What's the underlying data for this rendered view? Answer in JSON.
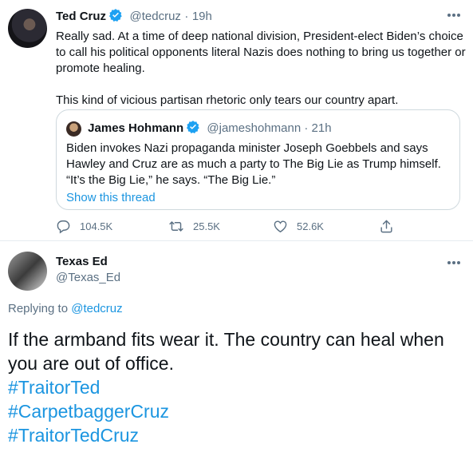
{
  "main_tweet": {
    "author_name": "Ted Cruz",
    "handle": "@tedcruz",
    "separator": "·",
    "time": "19h",
    "text_p1": "Really sad. At a time of deep national division, President-elect Biden’s choice to call his political opponents literal Nazis does nothing to bring us together or promote healing.",
    "text_p2": "This kind of vicious partisan rhetoric only tears our country apart.",
    "quoted": {
      "author_name": "James Hohmann",
      "handle": "@jameshohmann",
      "separator": "·",
      "time": "21h",
      "text": "Biden invokes Nazi propaganda minister Joseph Goebbels and says Hawley and Cruz are as much a party to The Big Lie as Trump himself. “It’s the Big Lie,” he says. “The Big Lie.”",
      "show_thread": "Show this thread"
    },
    "actions": {
      "replies": "104.5K",
      "retweets": "25.5K",
      "likes": "52.6K"
    }
  },
  "reply_tweet": {
    "author_name": "Texas Ed",
    "handle": "@Texas_Ed",
    "replying_prefix": "Replying to",
    "replying_handle": "@tedcruz",
    "text": "If the armband fits wear it. The country can heal when you are out of office.",
    "hashtags": [
      "#TraitorTed",
      "#CarpetbaggerCruz",
      "#TraitorTedCruz"
    ]
  },
  "colors": {
    "link": "#1b95e0",
    "muted": "#5b7083",
    "verified": "#1da1f2",
    "text": "#0f1419"
  },
  "icons": [
    "verified-badge-icon",
    "more-icon",
    "reply-icon",
    "retweet-icon",
    "like-icon",
    "share-icon"
  ]
}
